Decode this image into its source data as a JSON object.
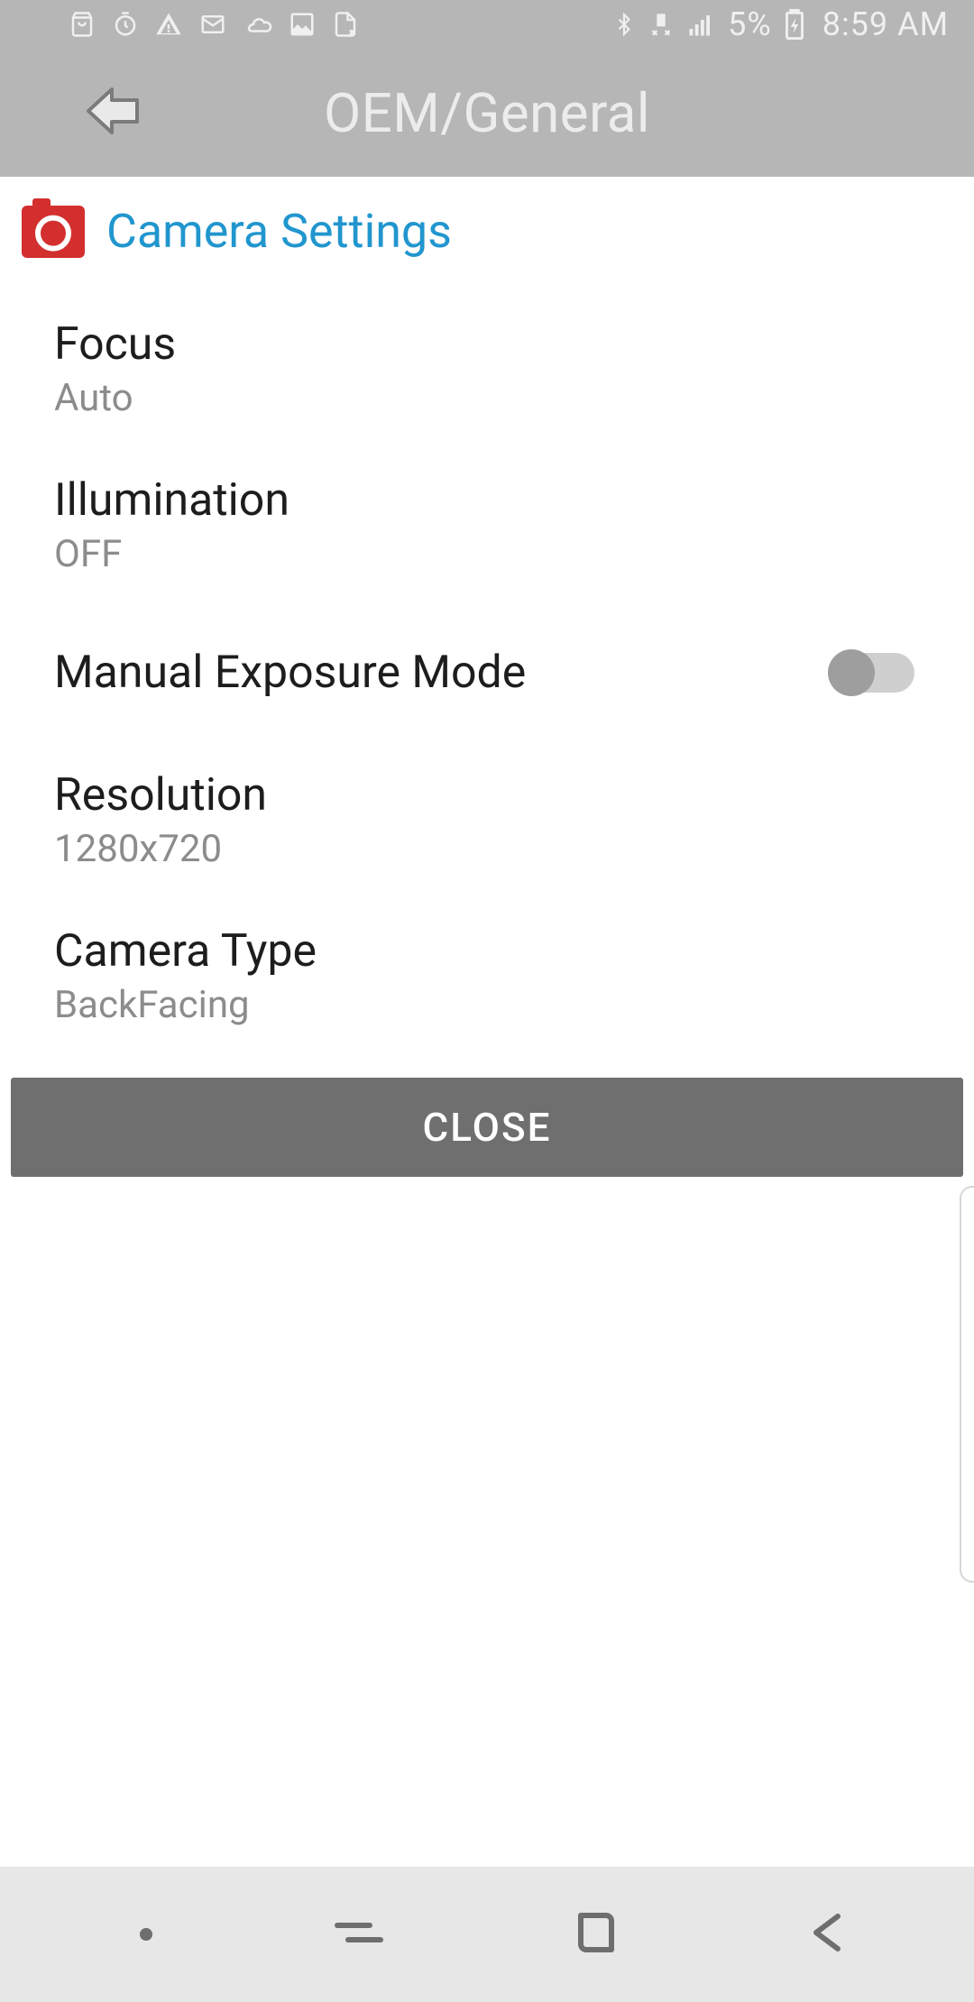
{
  "status": {
    "battery_percent": "5%",
    "time": "8:59 AM",
    "icons_left": [
      "shopping-bag-icon",
      "timer-icon",
      "warning-icon",
      "mail-icon",
      "cloud-outline-icon",
      "image-icon",
      "document-icon"
    ],
    "icons_right": [
      "bluetooth-icon",
      "network-activity-icon",
      "cell-signal-icon",
      "battery-charging-icon"
    ]
  },
  "appbar": {
    "title": "OEM/General",
    "back_icon": "back-arrow-icon"
  },
  "section": {
    "icon": "camera-icon",
    "title": "Camera Settings"
  },
  "settings": {
    "focus": {
      "label": "Focus",
      "value": "Auto"
    },
    "illumination": {
      "label": "Illumination",
      "value": "OFF"
    },
    "exposure": {
      "label": "Manual Exposure Mode",
      "enabled": false
    },
    "resolution": {
      "label": "Resolution",
      "value": "1280x720"
    },
    "camera_type": {
      "label": "Camera Type",
      "value": "BackFacing"
    }
  },
  "close_button": "CLOSE",
  "nav": {
    "recents_icon": "recents-icon",
    "home_icon": "home-outline-icon",
    "back_icon": "back-nav-icon"
  },
  "colors": {
    "appbar_bg": "#b6b6b6",
    "accent_blue": "#2196ce",
    "camera_red": "#d32f2f",
    "button_bg": "#706f6f"
  }
}
